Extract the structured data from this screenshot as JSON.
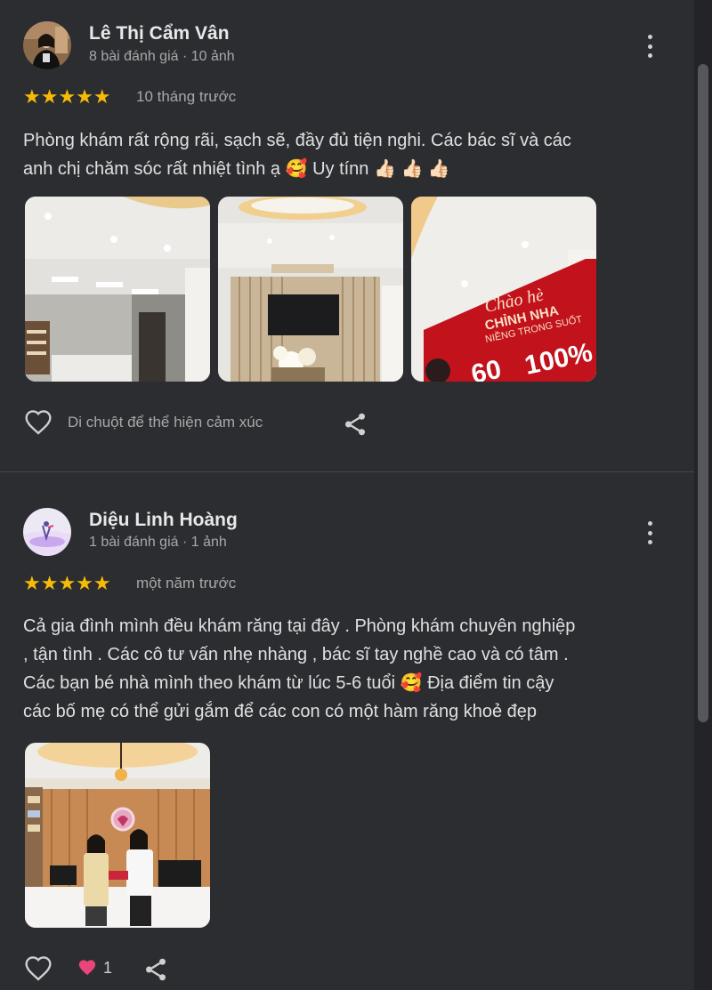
{
  "reviews": [
    {
      "author": "Lê Thị Cẩm Vân",
      "meta": "8 bài đánh giá · 10 ảnh",
      "stars": "★★★★★",
      "rating": 5,
      "when": "10 tháng trước",
      "text_line1": "Phòng khám rất rộng rãi, sạch sẽ, đầy đủ tiện nghi. Các bác sĩ và các",
      "text_line2": "anh chị chăm sóc rất nhiệt tình ạ 🥰 Uy tínn 👍🏻 👍🏻 👍🏻",
      "react_hint": "Di chuột để thể hiện cảm xúc",
      "photo3_text": {
        "line1": "Chào hè",
        "line2": "CHỈNH NHA",
        "line3": "NIỀNG TRONG SUỐT",
        "line4": "60",
        "line5": "100%"
      }
    },
    {
      "author": "Diệu Linh Hoàng",
      "meta": "1 bài đánh giá · 1 ảnh",
      "stars": "★★★★★",
      "rating": 5,
      "when": "một năm trước",
      "text_line1": "Cả gia đình mình đều khám răng tại đây . Phòng khám chuyên nghiệp",
      "text_line2": ", tận tình . Các cô tư vấn nhẹ nhàng , bác sĩ tay nghề cao và có tâm .",
      "text_line3": "Các bạn bé nhà mình theo khám từ lúc 5-6 tuổi 🥰 Địa điểm tin cậy",
      "text_line4": "các bố mẹ có thể gửi gắm để các con có một hàm răng khoẻ đẹp",
      "like_count": "1"
    }
  ],
  "icons": {
    "more": "more-vert-icon",
    "like": "heart-outline-icon",
    "liked": "heart-filled-icon",
    "share": "share-icon"
  },
  "colors": {
    "star": "#f6bb06",
    "background": "#2b2d31",
    "heart": "#e8457a"
  }
}
